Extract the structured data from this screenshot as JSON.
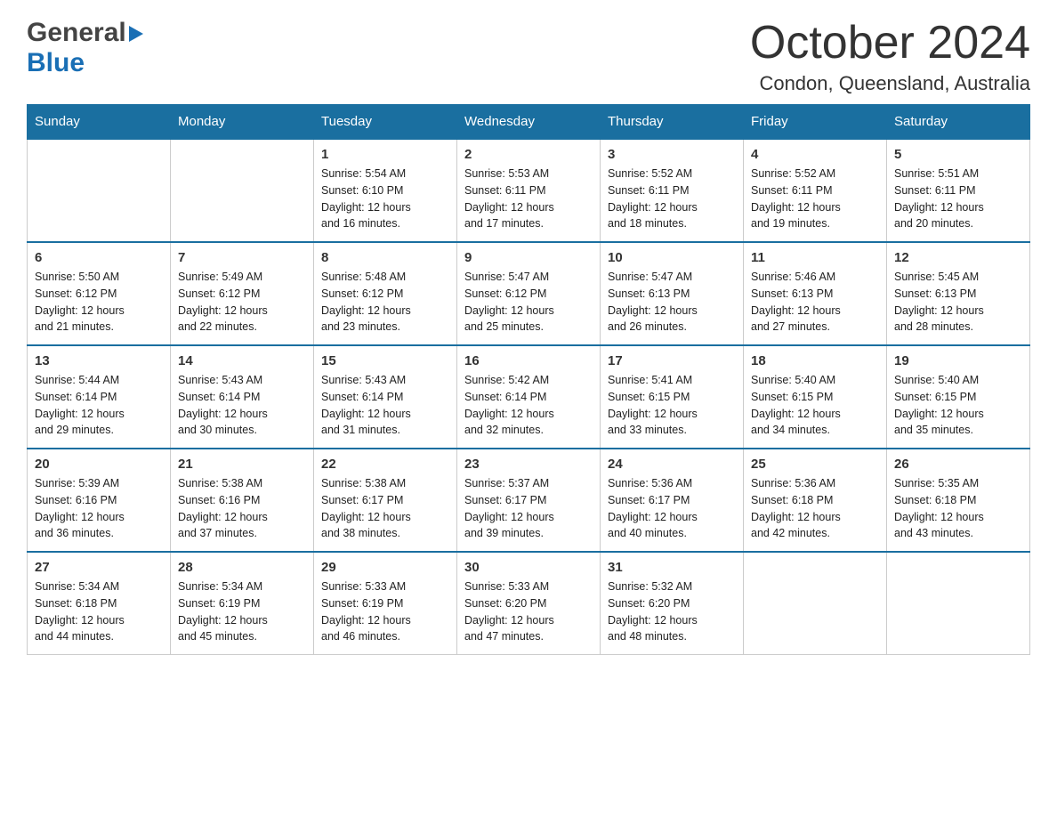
{
  "header": {
    "logo_general": "General",
    "logo_blue": "Blue",
    "title": "October 2024",
    "location": "Condon, Queensland, Australia"
  },
  "days_of_week": [
    "Sunday",
    "Monday",
    "Tuesday",
    "Wednesday",
    "Thursday",
    "Friday",
    "Saturday"
  ],
  "weeks": [
    [
      {
        "day": "",
        "info": ""
      },
      {
        "day": "",
        "info": ""
      },
      {
        "day": "1",
        "info": "Sunrise: 5:54 AM\nSunset: 6:10 PM\nDaylight: 12 hours\nand 16 minutes."
      },
      {
        "day": "2",
        "info": "Sunrise: 5:53 AM\nSunset: 6:11 PM\nDaylight: 12 hours\nand 17 minutes."
      },
      {
        "day": "3",
        "info": "Sunrise: 5:52 AM\nSunset: 6:11 PM\nDaylight: 12 hours\nand 18 minutes."
      },
      {
        "day": "4",
        "info": "Sunrise: 5:52 AM\nSunset: 6:11 PM\nDaylight: 12 hours\nand 19 minutes."
      },
      {
        "day": "5",
        "info": "Sunrise: 5:51 AM\nSunset: 6:11 PM\nDaylight: 12 hours\nand 20 minutes."
      }
    ],
    [
      {
        "day": "6",
        "info": "Sunrise: 5:50 AM\nSunset: 6:12 PM\nDaylight: 12 hours\nand 21 minutes."
      },
      {
        "day": "7",
        "info": "Sunrise: 5:49 AM\nSunset: 6:12 PM\nDaylight: 12 hours\nand 22 minutes."
      },
      {
        "day": "8",
        "info": "Sunrise: 5:48 AM\nSunset: 6:12 PM\nDaylight: 12 hours\nand 23 minutes."
      },
      {
        "day": "9",
        "info": "Sunrise: 5:47 AM\nSunset: 6:12 PM\nDaylight: 12 hours\nand 25 minutes."
      },
      {
        "day": "10",
        "info": "Sunrise: 5:47 AM\nSunset: 6:13 PM\nDaylight: 12 hours\nand 26 minutes."
      },
      {
        "day": "11",
        "info": "Sunrise: 5:46 AM\nSunset: 6:13 PM\nDaylight: 12 hours\nand 27 minutes."
      },
      {
        "day": "12",
        "info": "Sunrise: 5:45 AM\nSunset: 6:13 PM\nDaylight: 12 hours\nand 28 minutes."
      }
    ],
    [
      {
        "day": "13",
        "info": "Sunrise: 5:44 AM\nSunset: 6:14 PM\nDaylight: 12 hours\nand 29 minutes."
      },
      {
        "day": "14",
        "info": "Sunrise: 5:43 AM\nSunset: 6:14 PM\nDaylight: 12 hours\nand 30 minutes."
      },
      {
        "day": "15",
        "info": "Sunrise: 5:43 AM\nSunset: 6:14 PM\nDaylight: 12 hours\nand 31 minutes."
      },
      {
        "day": "16",
        "info": "Sunrise: 5:42 AM\nSunset: 6:14 PM\nDaylight: 12 hours\nand 32 minutes."
      },
      {
        "day": "17",
        "info": "Sunrise: 5:41 AM\nSunset: 6:15 PM\nDaylight: 12 hours\nand 33 minutes."
      },
      {
        "day": "18",
        "info": "Sunrise: 5:40 AM\nSunset: 6:15 PM\nDaylight: 12 hours\nand 34 minutes."
      },
      {
        "day": "19",
        "info": "Sunrise: 5:40 AM\nSunset: 6:15 PM\nDaylight: 12 hours\nand 35 minutes."
      }
    ],
    [
      {
        "day": "20",
        "info": "Sunrise: 5:39 AM\nSunset: 6:16 PM\nDaylight: 12 hours\nand 36 minutes."
      },
      {
        "day": "21",
        "info": "Sunrise: 5:38 AM\nSunset: 6:16 PM\nDaylight: 12 hours\nand 37 minutes."
      },
      {
        "day": "22",
        "info": "Sunrise: 5:38 AM\nSunset: 6:17 PM\nDaylight: 12 hours\nand 38 minutes."
      },
      {
        "day": "23",
        "info": "Sunrise: 5:37 AM\nSunset: 6:17 PM\nDaylight: 12 hours\nand 39 minutes."
      },
      {
        "day": "24",
        "info": "Sunrise: 5:36 AM\nSunset: 6:17 PM\nDaylight: 12 hours\nand 40 minutes."
      },
      {
        "day": "25",
        "info": "Sunrise: 5:36 AM\nSunset: 6:18 PM\nDaylight: 12 hours\nand 42 minutes."
      },
      {
        "day": "26",
        "info": "Sunrise: 5:35 AM\nSunset: 6:18 PM\nDaylight: 12 hours\nand 43 minutes."
      }
    ],
    [
      {
        "day": "27",
        "info": "Sunrise: 5:34 AM\nSunset: 6:18 PM\nDaylight: 12 hours\nand 44 minutes."
      },
      {
        "day": "28",
        "info": "Sunrise: 5:34 AM\nSunset: 6:19 PM\nDaylight: 12 hours\nand 45 minutes."
      },
      {
        "day": "29",
        "info": "Sunrise: 5:33 AM\nSunset: 6:19 PM\nDaylight: 12 hours\nand 46 minutes."
      },
      {
        "day": "30",
        "info": "Sunrise: 5:33 AM\nSunset: 6:20 PM\nDaylight: 12 hours\nand 47 minutes."
      },
      {
        "day": "31",
        "info": "Sunrise: 5:32 AM\nSunset: 6:20 PM\nDaylight: 12 hours\nand 48 minutes."
      },
      {
        "day": "",
        "info": ""
      },
      {
        "day": "",
        "info": ""
      }
    ]
  ]
}
